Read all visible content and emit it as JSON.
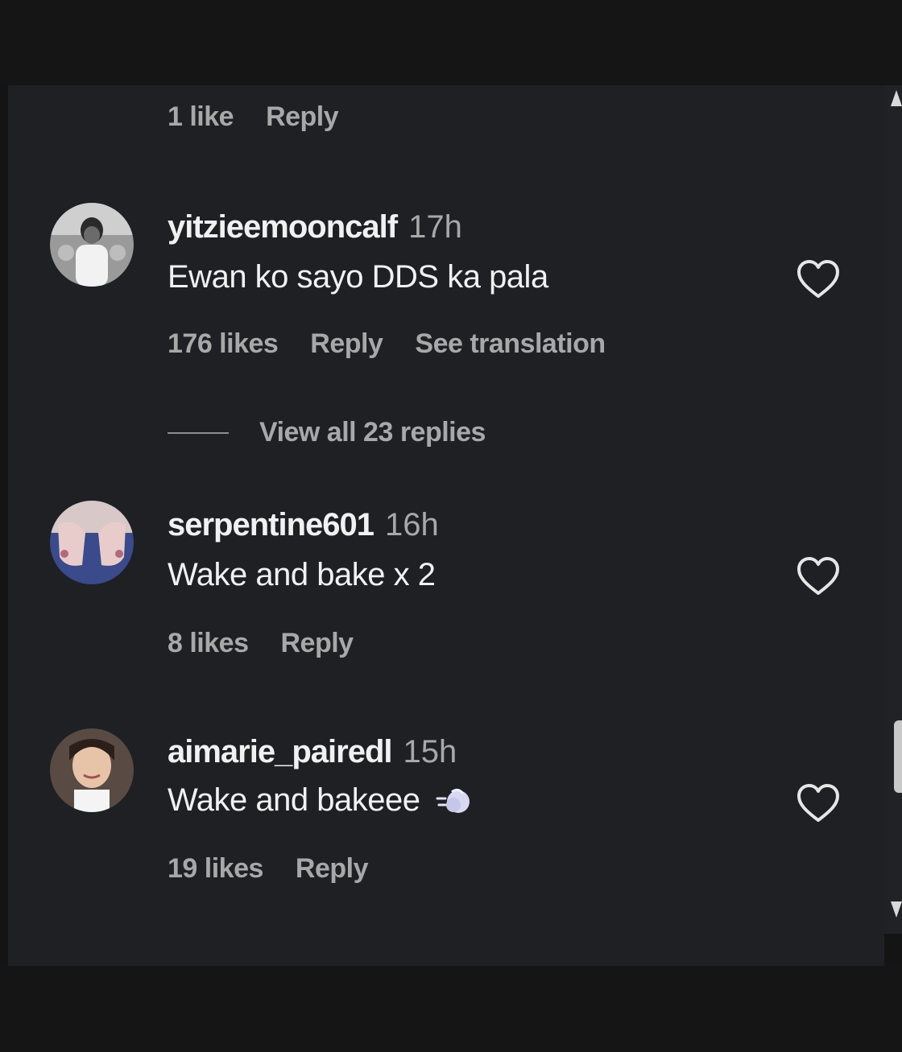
{
  "top_comment_meta": {
    "likes": "1 like",
    "reply": "Reply"
  },
  "comments": [
    {
      "username": "yitzieemooncalf",
      "time": "17h",
      "text": "Ewan ko sayo DDS ka pala",
      "likes": "176 likes",
      "reply": "Reply",
      "translation": "See translation",
      "view_replies": "View all 23 replies"
    },
    {
      "username": "serpentine601",
      "time": "16h",
      "text": "Wake and bake x 2",
      "likes": "8 likes",
      "reply": "Reply"
    },
    {
      "username": "aimarie_pairedl",
      "time": "15h",
      "text": "Wake and bakeee",
      "emoji": "💨",
      "likes": "19 likes",
      "reply": "Reply"
    }
  ],
  "icons": {
    "like": "heart-outline-icon",
    "scroll_up": "triangle-up-icon",
    "scroll_down": "triangle-down-icon"
  },
  "colors": {
    "background": "#1e2024",
    "primary_text": "#f1f1f1",
    "secondary_text": "#a8a8a8"
  }
}
